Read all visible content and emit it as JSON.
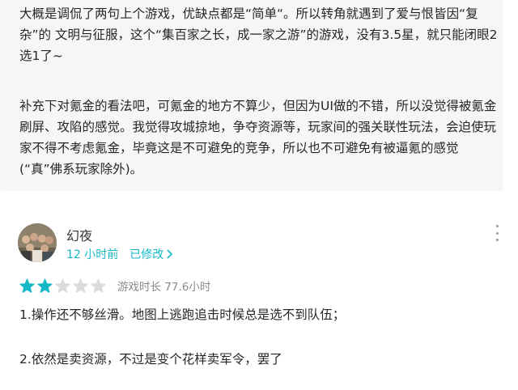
{
  "previous_review": {
    "paragraph_1": "大概是调侃了两句上个游戏，优缺点都是“简单“。所以转角就遇到了爱与恨皆因“复杂”的 文明与征服，这个“集百家之长，成一家之游”的游戏，没有3.5星，就只能闭眼2选1了~",
    "paragraph_2": "补充下对氪金的看法吧，可氪金的地方不算少，但因为UI做的不错，所以没觉得被氪金刷屏、攻陷的感觉。我觉得攻城掠地，争夺资源等，玩家间的强关联性玩法，会迫使玩家不得不考虑氪金，毕竟这是不可避免的竞争，所以也不可避免有被逼氪的感觉(“真”佛系玩家除外)。"
  },
  "review": {
    "username": "幻夜",
    "time_ago": "12 小时前",
    "edited_label": "已修改",
    "rating": 2,
    "rating_max": 5,
    "playtime": "游戏时长 77.6小时",
    "lines": [
      "1.操作还不够丝滑。地图上逃跑追击时候总是选不到队伍；",
      "2.依然是卖资源，不过是变个花样卖军令，罢了"
    ]
  },
  "icons": {
    "more": "more-vertical-icon",
    "edited_chevron": "chevron-right-icon",
    "star": "star-icon"
  },
  "colors": {
    "accent": "#14b9c8",
    "star_filled": "#14b9c8",
    "star_empty": "#dcdcdc",
    "card_bg": "#f6f6f6",
    "muted_text": "#8a8a8a"
  }
}
